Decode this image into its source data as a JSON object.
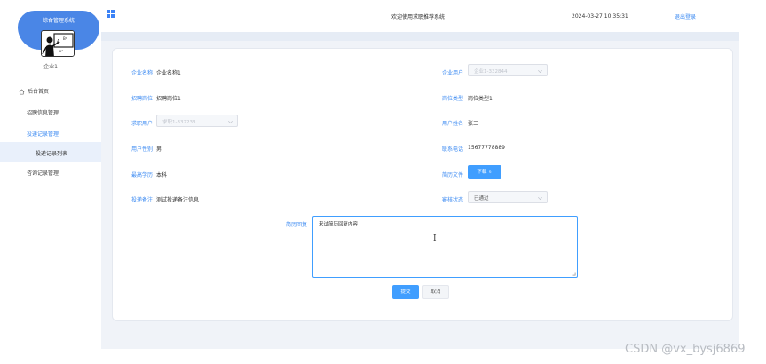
{
  "sidebar": {
    "system_title": "综合管理系统",
    "username": "企业1",
    "menu": {
      "home": "后台首页",
      "recruit_info": "招聘信息管理",
      "delivery_records": "投递记录管理",
      "delivery_list": "投递记录列表",
      "consult_records": "咨询记录管理"
    }
  },
  "topbar": {
    "welcome": "欢迎使用求职推荐系统",
    "datetime": "2024-03-27 10:35:31",
    "logout": "退出登录"
  },
  "form": {
    "company_name": {
      "label": "企业名称",
      "value": "企业名称1"
    },
    "company_user": {
      "label": "企业用户",
      "value": "企业1-332844"
    },
    "job_title": {
      "label": "招聘岗位",
      "value": "招聘岗位1"
    },
    "job_type": {
      "label": "岗位类型",
      "value": "岗位类型1"
    },
    "applicant": {
      "label": "求职用户",
      "value": "求职1-332233"
    },
    "user_name": {
      "label": "用户姓名",
      "value": "张三"
    },
    "gender": {
      "label": "用户性别",
      "value": "男"
    },
    "phone": {
      "label": "联系电话",
      "value": "15677778889"
    },
    "education": {
      "label": "最高学历",
      "value": "本科"
    },
    "resume": {
      "label": "简历文件",
      "button": "下载 ⇩"
    },
    "remark": {
      "label": "投递备注",
      "value": "测试投递备注信息"
    },
    "review_status": {
      "label": "審核状态",
      "value": "已通过"
    },
    "reply": {
      "label": "简历回复",
      "value": "来试简历回复内容",
      "cursor": "I"
    },
    "submit": "提交",
    "cancel": "取消"
  },
  "watermark": "CSDN @vx_bysj6869",
  "colors": {
    "accent": "#409eff",
    "sidebar_logo": "#4a86e6",
    "label": "#3d8bf2"
  }
}
